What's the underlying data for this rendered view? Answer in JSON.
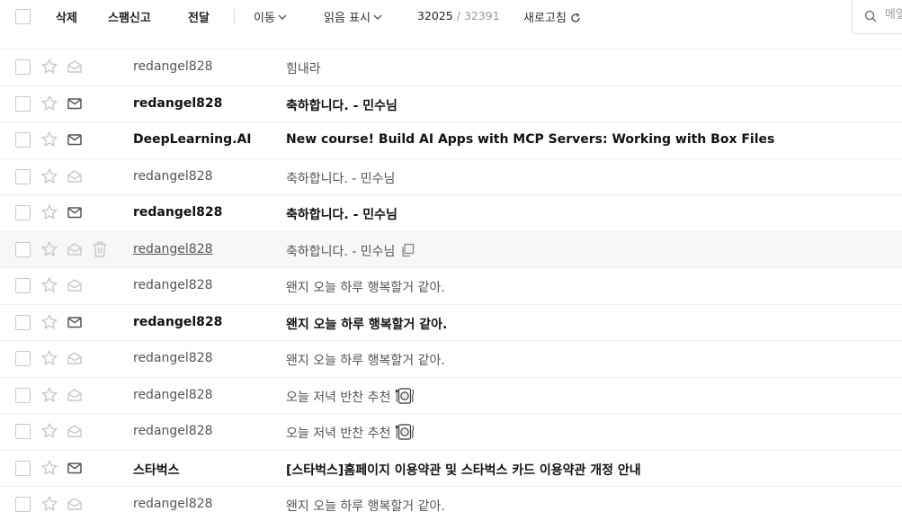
{
  "toolbar": {
    "delete_label": "삭제",
    "spam_label": "스팸신고",
    "forward_label": "전달",
    "move_label": "이동",
    "read_mark_label": "읽음 표시",
    "count_current": "32025",
    "count_separator": "/",
    "count_total": "32391",
    "refresh_label": "새로고침"
  },
  "search": {
    "placeholder": "메일 검색"
  },
  "colors": {
    "icon_gray": "#c9c9c9",
    "icon_dark": "#555555",
    "unread_text": "#111111",
    "read_text": "#555555"
  },
  "messages": [
    {
      "sender": "redangel828",
      "subject": "힘내라",
      "unread": false
    },
    {
      "sender": "redangel828",
      "subject": "축하합니다. - 민수님",
      "unread": true
    },
    {
      "sender": "DeepLearning.AI",
      "subject": "New course! Build AI Apps with MCP Servers: Working with Box Files",
      "unread": true
    },
    {
      "sender": "redangel828",
      "subject": "축하합니다. - 민수님",
      "unread": false
    },
    {
      "sender": "redangel828",
      "subject": "축하합니다. - 민수님",
      "unread": true
    },
    {
      "sender": "redangel828",
      "subject": "축하합니다. - 민수님",
      "unread": false,
      "hovered": true,
      "icon": "copy-icon"
    },
    {
      "sender": "redangel828",
      "subject": "왠지 오늘 하루 행복할거 같아.",
      "unread": false
    },
    {
      "sender": "redangel828",
      "subject": "왠지 오늘 하루 행복할거 같아.",
      "unread": true
    },
    {
      "sender": "redangel828",
      "subject": "왠지 오늘 하루 행복할거 같아.",
      "unread": false
    },
    {
      "sender": "redangel828",
      "subject": "오늘 저녁 반찬 추천",
      "unread": false,
      "icon": "meal-icon"
    },
    {
      "sender": "redangel828",
      "subject": "오늘 저녁 반찬 추천",
      "unread": false,
      "icon": "meal-icon"
    },
    {
      "sender": "스타벅스",
      "subject": "[스타벅스]홈페이지 이용약관 및 스타벅스 카드 이용약관 개정 안내",
      "unread": true
    },
    {
      "sender": "redangel828",
      "subject": "왠지 오늘 하루 행복할거 같아.",
      "unread": false
    }
  ]
}
